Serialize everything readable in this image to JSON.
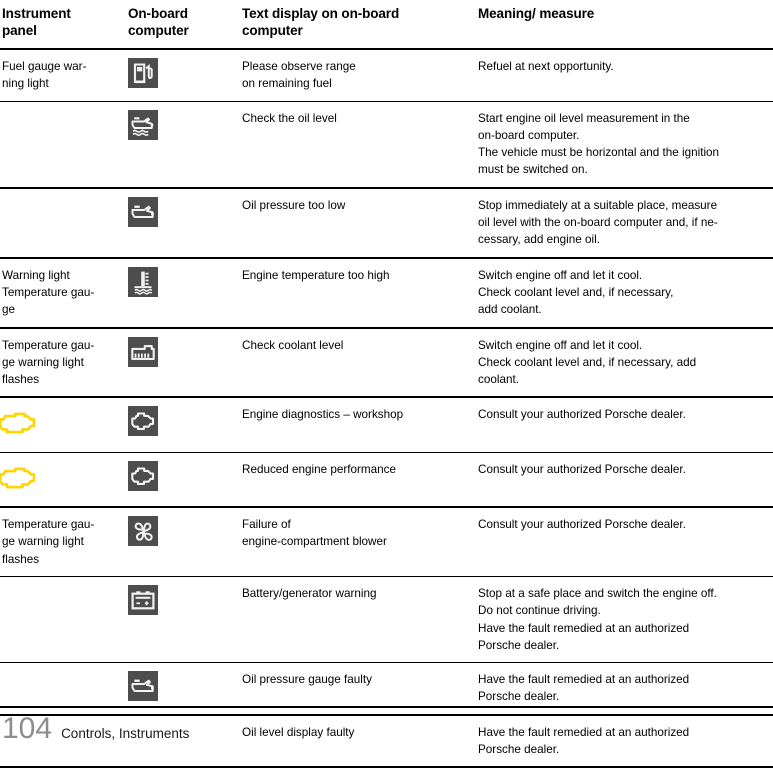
{
  "document": {
    "type": "owners-manual-table",
    "accent_yellow": "#FFD400",
    "icon_chip_background": "#4d4d4d",
    "icon_glyph_color": "#f2f2f2"
  },
  "table": {
    "headers": [
      "Instrument panel",
      "On-board computer",
      "Text display on on-board computer",
      "Meaning/ measure"
    ],
    "header_lines": [
      [
        "Instrument",
        "panel"
      ],
      [
        "On-board",
        "computer"
      ],
      [
        "Text display on on-board",
        "computer"
      ],
      [
        "Meaning/ measure"
      ]
    ],
    "rows": [
      {
        "instrument_lines": [
          "Fuel gauge war-",
          "ning light"
        ],
        "instrument_icon": null,
        "obc_icon": "fuel-pump-icon",
        "text_display_lines": [
          "Please observe range",
          "on remaining fuel"
        ],
        "meaning_lines": [
          "Refuel at next opportunity."
        ],
        "thick_rule": false
      },
      {
        "instrument_lines": [],
        "instrument_icon": null,
        "obc_icon": "oil-can-level-icon",
        "text_display_lines": [
          "Check the oil level"
        ],
        "meaning_lines": [
          "Start engine oil level measurement in the",
          "on-board computer.",
          "The vehicle must be horizontal and the ignition",
          "must be switched on."
        ],
        "thick_rule": true
      },
      {
        "instrument_lines": [],
        "instrument_icon": null,
        "obc_icon": "oil-can-pressure-icon",
        "text_display_lines": [
          "Oil pressure too low"
        ],
        "meaning_lines": [
          "Stop immediately at a suitable place, measure",
          "oil level with the on-board computer and, if ne-",
          "cessary, add engine oil."
        ],
        "thick_rule": true
      },
      {
        "instrument_lines": [
          "Warning light",
          "Temperature gau-",
          "ge"
        ],
        "instrument_icon": null,
        "obc_icon": "coolant-temperature-icon",
        "text_display_lines": [
          "Engine temperature too high"
        ],
        "meaning_lines": [
          "Switch engine off and let it cool.",
          "Check coolant level and, if necessary,",
          "add coolant."
        ],
        "thick_rule": true
      },
      {
        "instrument_lines": [
          "Temperature gau-",
          "ge warning light",
          "flashes"
        ],
        "instrument_icon": null,
        "obc_icon": "coolant-level-icon",
        "text_display_lines": [
          "Check coolant level"
        ],
        "meaning_lines": [
          "Switch engine off and let it cool.",
          "Check coolant level and, if necessary, add",
          "coolant."
        ],
        "thick_rule": true
      },
      {
        "instrument_lines": [],
        "instrument_icon": "check-engine-tell-tale-icon",
        "obc_icon": "engine-block-icon",
        "text_display_lines": [
          "Engine diagnostics – workshop"
        ],
        "meaning_lines": [
          "Consult your authorized Porsche dealer."
        ],
        "thick_rule": false
      },
      {
        "instrument_lines": [],
        "instrument_icon": "check-engine-tell-tale-icon",
        "obc_icon": "engine-block-icon",
        "text_display_lines": [
          "Reduced engine performance"
        ],
        "meaning_lines": [
          "Consult your authorized Porsche dealer."
        ],
        "thick_rule": true
      },
      {
        "instrument_lines": [
          "Temperature gau-",
          "ge warning light",
          "flashes"
        ],
        "instrument_icon": null,
        "obc_icon": "engine-blower-fan-icon",
        "text_display_lines": [
          "Failure of",
          "engine-compartment blower"
        ],
        "meaning_lines": [
          "Consult your authorized Porsche dealer."
        ],
        "thick_rule": false
      },
      {
        "instrument_lines": [],
        "instrument_icon": null,
        "obc_icon": "battery-icon",
        "text_display_lines": [
          "Battery/generator warning"
        ],
        "meaning_lines": [
          "Stop at a safe place and switch the engine off.",
          "Do not continue driving.",
          "Have the fault remedied at an authorized",
          "Porsche dealer."
        ],
        "thick_rule": false
      },
      {
        "instrument_lines": [],
        "instrument_icon": null,
        "obc_icon": "oil-can-pressure-icon",
        "text_display_lines": [
          "Oil pressure gauge faulty"
        ],
        "meaning_lines": [
          "Have the fault remedied at an authorized",
          "Porsche dealer."
        ],
        "thick_rule": true
      },
      {
        "instrument_lines": [],
        "instrument_icon": null,
        "obc_icon": null,
        "text_display_lines": [
          "Oil level display faulty"
        ],
        "meaning_lines": [
          "Have the fault remedied at an authorized",
          "Porsche dealer."
        ],
        "thick_rule": true
      }
    ]
  },
  "footer": {
    "page_number": "104",
    "section": "Controls, Instruments"
  }
}
